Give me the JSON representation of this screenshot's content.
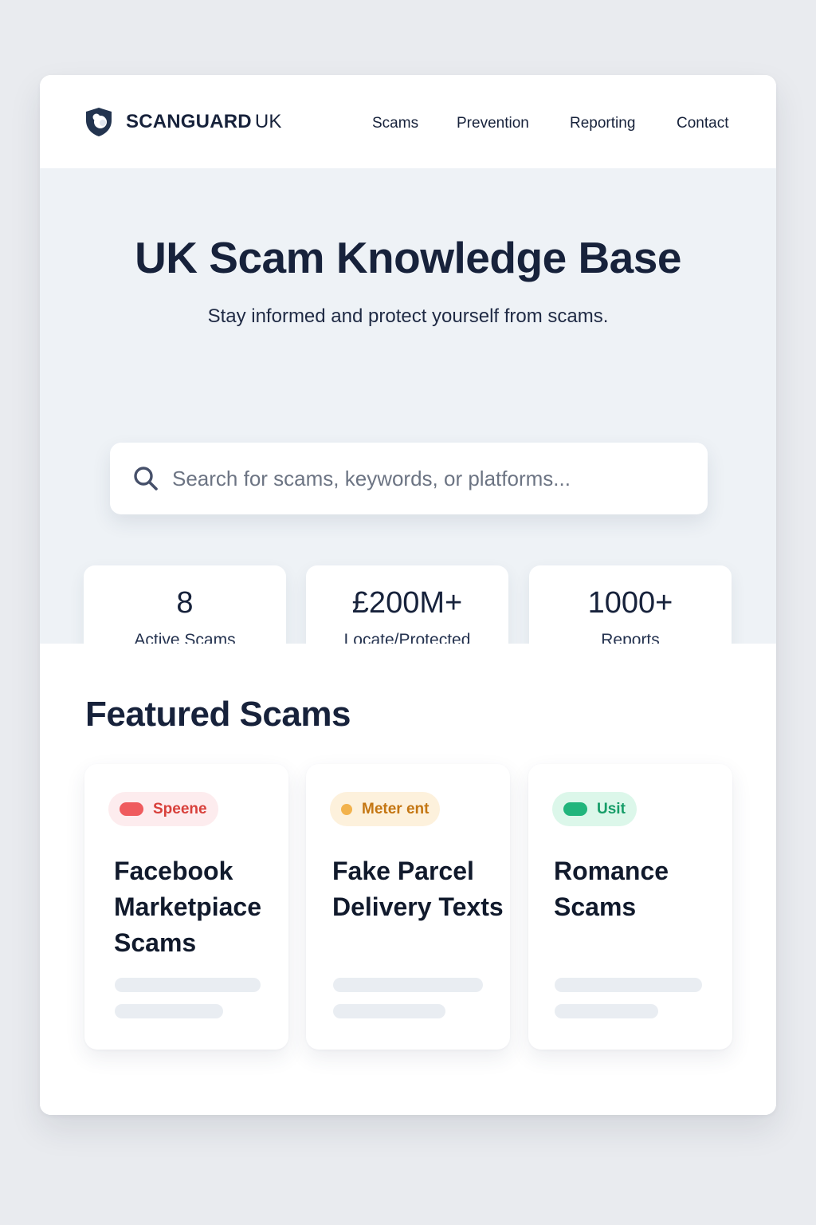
{
  "header": {
    "brand_name": "SCANGUARD",
    "brand_suffix": "UK",
    "nav": [
      "Scams",
      "Prevention",
      "Reporting",
      "Contact"
    ]
  },
  "hero": {
    "title": "UK Scam Knowledge Base",
    "subtitle": "Stay informed and protect yourself from scams.",
    "search_placeholder": "Search for scams, keywords, or platforms..."
  },
  "stats": [
    {
      "value": "8",
      "label": "Active Scams"
    },
    {
      "value": "£200M+",
      "label": "Locate/Protected"
    },
    {
      "value": "1000+",
      "label": "Reports"
    }
  ],
  "featured": {
    "title": "Featured Scams",
    "cards": [
      {
        "badge": "Speene",
        "badge_color": "#e2403f",
        "badge_bg": "#fdecee",
        "title": "Facebook Marketpiace Scams"
      },
      {
        "badge": "Meter ent",
        "badge_color": "#c77a12",
        "badge_bg": "#fdf1dc",
        "title": "Fake Parcel Delivery Texts"
      },
      {
        "badge": "Usit",
        "badge_color": "#17a06b",
        "badge_bg": "#dcf7ea",
        "title": "Romance Scams"
      }
    ]
  },
  "colors": {
    "accent_navy": "#17223b",
    "hero_bg": "#eef2f6",
    "page_bg": "#e9ebef"
  },
  "icons": {
    "logo": "shield-icon",
    "search": "search-icon"
  }
}
